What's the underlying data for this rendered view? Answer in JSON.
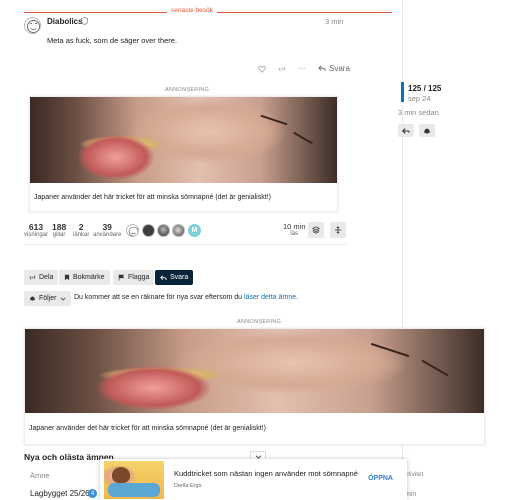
{
  "last_visit_label": "senaste besök",
  "post": {
    "username": "Diabolics",
    "badge_icon": "shield-icon",
    "date": "3 min",
    "body": "Meta as fuck, som de säger over there.",
    "reply_label": "Svara"
  },
  "timeline": {
    "count": "125 / 125",
    "date": "sep 24",
    "ago": "3 min sedan"
  },
  "ads": [
    {
      "label": "ANNONSERING",
      "caption": "Japaner använder det här tricket för att minska sömnapné (det är genialiskt!)"
    },
    {
      "label": "ANNONSERING",
      "caption": "Japaner använder det här tricket för att minska sömnapné (det är genialiskt!)"
    }
  ],
  "topic_map": {
    "stats": [
      {
        "num": "613",
        "label": "visningar"
      },
      {
        "num": "188",
        "label": "gillar"
      },
      {
        "num": "2",
        "label": "länkar"
      },
      {
        "num": "39",
        "label": "användare"
      }
    ],
    "participant_letter": "M",
    "time_num": "10 min",
    "time_label": "läs"
  },
  "footer_buttons": {
    "share": "Dela",
    "bookmark": "Bokmärke",
    "flag": "Flagga",
    "reply": "Svara"
  },
  "notifications": {
    "button": "Följer",
    "text_before": "Du kommer att se en räknare för nya svar eftersom du ",
    "link": "läser detta ämne",
    "text_after": "."
  },
  "suggested": {
    "title": "Nya och olästa ämnen",
    "col_topic": "Ämne",
    "col_activity": "ktivitet",
    "row_title": "Lagbygget 25/26",
    "row_badge": "4",
    "row_activity": "min"
  },
  "float_ad": {
    "title": "Kuddtricket som nästan ingen använder mot sömnapné",
    "sponsor": "Derila Ergo",
    "cta": "ÖPPNA"
  }
}
